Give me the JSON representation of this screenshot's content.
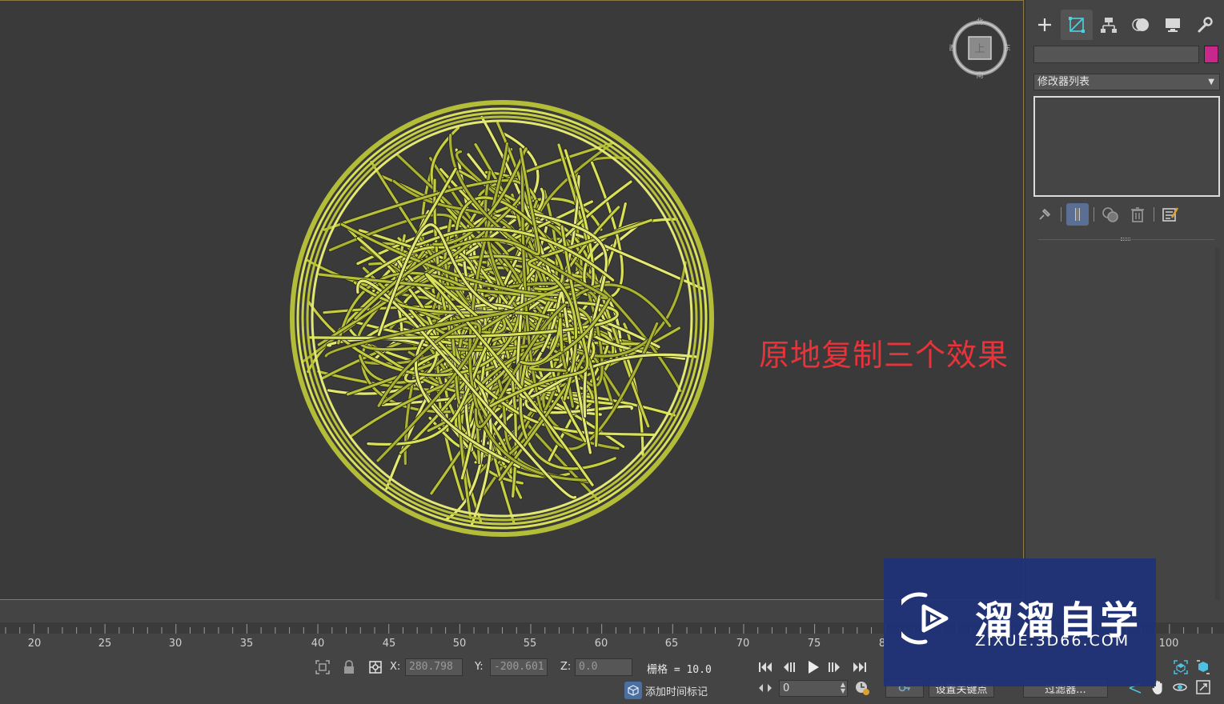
{
  "viewport": {
    "annotation": "原地复制三个效果",
    "viewcube": {
      "top_face": "上",
      "north": "北",
      "south": "南",
      "east": "东",
      "west": "西"
    }
  },
  "command_panel": {
    "tabs": [
      {
        "name": "create",
        "icon": "plus-icon"
      },
      {
        "name": "modify",
        "icon": "modify-icon",
        "active": true
      },
      {
        "name": "hierarchy",
        "icon": "hierarchy-icon"
      },
      {
        "name": "motion",
        "icon": "motion-icon"
      },
      {
        "name": "display",
        "icon": "display-icon"
      },
      {
        "name": "utilities",
        "icon": "wrench-icon"
      }
    ],
    "object_name": "",
    "object_color": "#c8288c",
    "modifier_list": "修改器列表"
  },
  "timeline": {
    "ticks": [
      "20",
      "25",
      "30",
      "35",
      "40",
      "45",
      "50",
      "55",
      "60",
      "65",
      "70",
      "75",
      "8",
      "100"
    ]
  },
  "status": {
    "x_label": "X:",
    "x_value": "280.798",
    "y_label": "Y:",
    "y_value": "-200.601",
    "z_label": "Z:",
    "z_value": "0.0",
    "grid": "栅格 = 10.0",
    "add_time_tag": "添加时间标记",
    "frame_value": "0",
    "set_key": "设置关键点",
    "filters": "过滤器..."
  },
  "watermark": {
    "title": "溜溜自学",
    "url": "ZIXUE.3D66.COM"
  },
  "colors": {
    "annotation": "#e8333a",
    "wire": "#c8d24a",
    "accent_active": "#5a6f93",
    "watermark_bg": "#1e3278"
  }
}
